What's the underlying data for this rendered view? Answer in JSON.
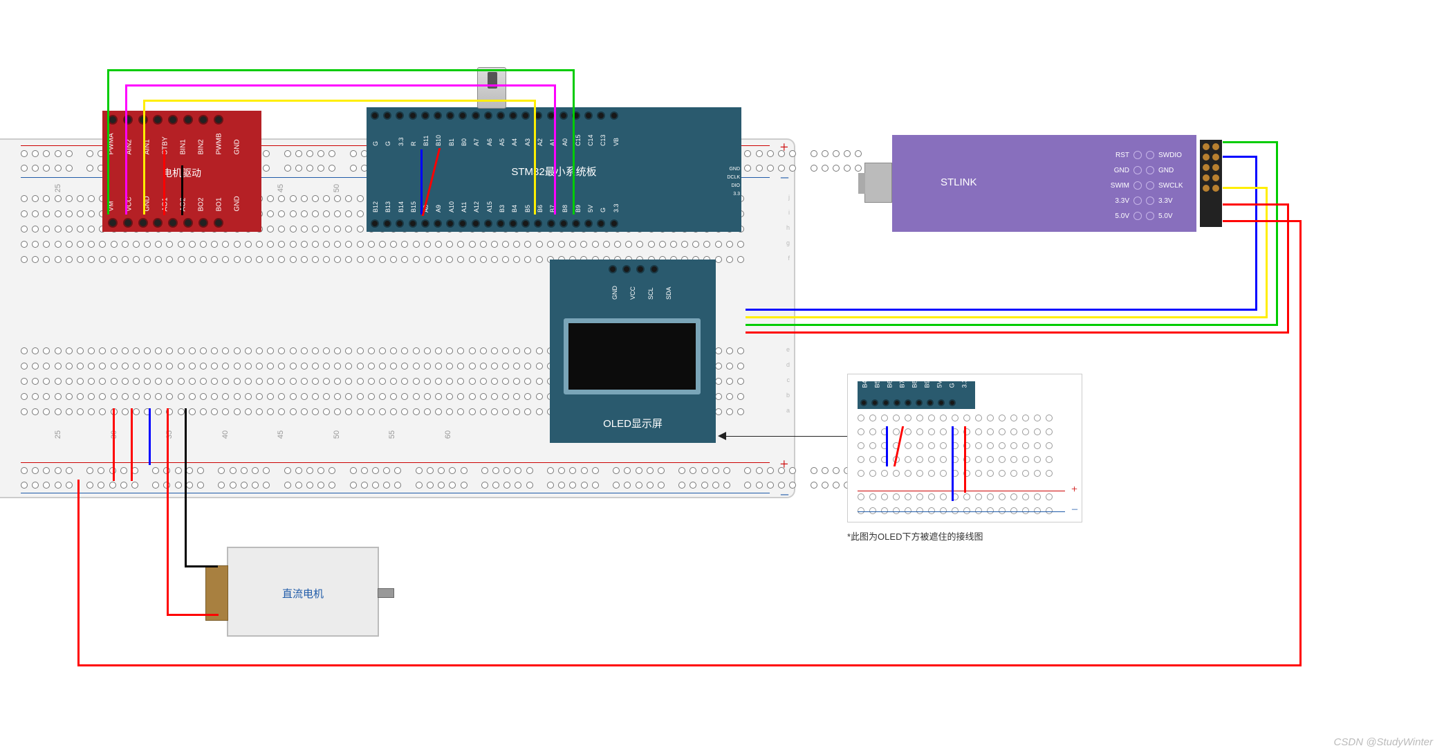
{
  "watermark": "CSDN @StudyWinter",
  "motor_driver": {
    "title": "电机驱动",
    "top_pins": [
      "PWMA",
      "AIN2",
      "AIN1",
      "STBY",
      "BIN1",
      "BIN2",
      "PWMB",
      "GND"
    ],
    "bot_pins": [
      "VM",
      "VCC",
      "GND",
      "AO1",
      "AO2",
      "BO2",
      "BO1",
      "GND"
    ]
  },
  "stm32": {
    "title": "STM32最小系统板",
    "top_pins": [
      "G",
      "G",
      "3.3",
      "R",
      "B11",
      "B10",
      "B1",
      "B0",
      "A7",
      "A6",
      "A5",
      "A4",
      "A3",
      "A2",
      "A1",
      "A0",
      "C15",
      "C14",
      "C13",
      "VB"
    ],
    "bot_pins": [
      "B12",
      "B13",
      "B14",
      "B15",
      "A8",
      "A9",
      "A10",
      "A11",
      "A12",
      "A15",
      "B3",
      "B4",
      "B5",
      "B6",
      "B7",
      "B8",
      "B9",
      "5V",
      "G",
      "3.3"
    ],
    "side_labels": [
      "GND",
      "DCLK",
      "DIO",
      "3.3"
    ]
  },
  "oled": {
    "title": "OLED显示屏",
    "pins": [
      "GND",
      "VCC",
      "SCL",
      "SDA"
    ]
  },
  "dc_motor": {
    "title": "直流电机"
  },
  "stlink": {
    "title": "STLINK",
    "left_labels": [
      "RST",
      "GND",
      "SWIM",
      "3.3V",
      "5.0V"
    ],
    "right_labels": [
      "SWDIO",
      "GND",
      "SWCLK",
      "3.3V",
      "5.0V"
    ]
  },
  "breadboard": {
    "rail_plus": "+",
    "rail_minus": "–",
    "col_numbers": [
      "25",
      "30",
      "35",
      "40",
      "45",
      "50",
      "55",
      "60"
    ],
    "row_labels_top": [
      "j",
      "i",
      "h",
      "g",
      "f"
    ],
    "row_labels_bot": [
      "e",
      "d",
      "c",
      "b",
      "a"
    ]
  },
  "inset": {
    "strip_labels": [
      "B4",
      "B5",
      "B6",
      "B7",
      "B8",
      "B9",
      "5V",
      "G",
      "3.3"
    ],
    "note": "*此图为OLED下方被遮住的接线图",
    "rail_plus": "+",
    "rail_minus": "–"
  },
  "wire_colors": {
    "green": "#00cc00",
    "magenta": "#ff00ff",
    "yellow": "#ffee00",
    "red": "#ff0000",
    "blue": "#0000ff",
    "black": "#000000"
  }
}
